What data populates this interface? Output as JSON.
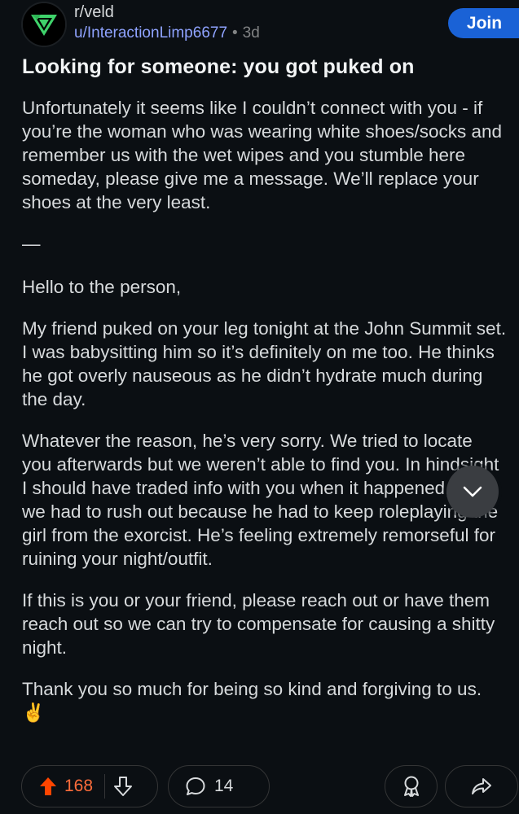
{
  "post": {
    "subreddit": "r/veld",
    "author": "u/InteractionLimp6677",
    "separator": "•",
    "age": "3d",
    "join_label": "Join",
    "title": "Looking for someone: you got puked on",
    "paragraphs": [
      "Unfortunately it seems like I couldn’t connect with you - if you’re the woman who was wearing white shoes/socks and remember us with the wet wipes and you stumble here someday, please give me a message. We’ll replace your shoes at the very least.",
      "—",
      "Hello to the person,",
      "My friend puked on your leg tonight at the John Summit set. I was babysitting him so it’s definitely on me too. He thinks he got overly nauseous as he didn’t hydrate much during the day.",
      "Whatever the reason, he’s very sorry. We tried to locate you afterwards but we weren’t able to find you. In hindsight I should have traded info with you when it happened, but we had to rush out because he had to keep roleplaying the girl from the exorcist. He’s feeling extremely remorseful for ruining your night/outfit.",
      "If this is you or your friend, please reach out or have them reach out so we can try to compensate for causing a shitty night.",
      "Thank you so much for being so kind and forgiving to us. ✌️"
    ]
  },
  "actions": {
    "upvotes": "168",
    "comments": "14"
  },
  "icons": {
    "avatar": "veld-logo",
    "scroll": "chevron-down-icon",
    "upvote": "arrow-up-icon",
    "downvote": "arrow-down-icon",
    "comment": "speech-bubble-icon",
    "award": "award-icon",
    "share": "share-icon"
  },
  "colors": {
    "background": "#0b0f13",
    "join": "#1a62d6",
    "upvote": "#ff4500",
    "author_link": "#8fa3ff"
  }
}
